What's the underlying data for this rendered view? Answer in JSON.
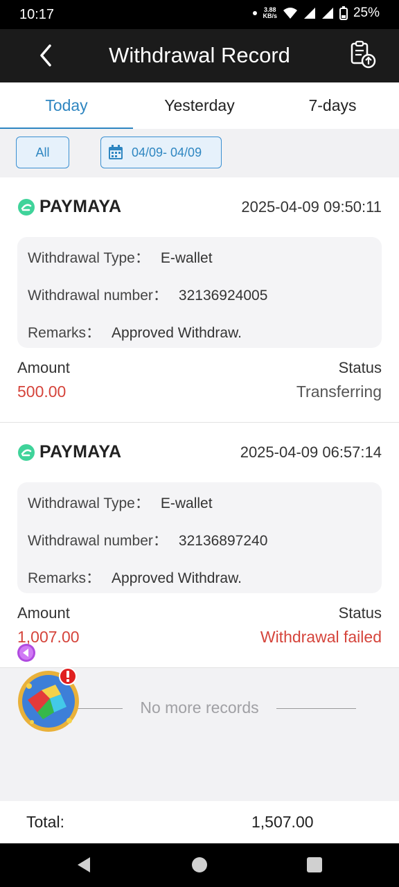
{
  "status_bar": {
    "time": "10:17",
    "net_speed_value": "3.88",
    "net_speed_unit": "KB/s",
    "battery": "25%"
  },
  "header": {
    "title": "Withdrawal Record"
  },
  "tabs": [
    {
      "label": "Today",
      "active": true
    },
    {
      "label": "Yesterday",
      "active": false
    },
    {
      "label": "7-days",
      "active": false
    }
  ],
  "filters": {
    "all_label": "All",
    "date_range": "04/09- 04/09"
  },
  "records": [
    {
      "brand": "PAYMAYA",
      "datetime": "2025-04-09 09:50:11",
      "type_label": "Withdrawal Type：",
      "type_value": "E-wallet",
      "number_label": "Withdrawal number：",
      "number_value": "32136924005",
      "remarks_label": "Remarks：",
      "remarks_value": "Approved Withdraw.",
      "amount_label": "Amount",
      "amount_value": "500.00",
      "status_label": "Status",
      "status_value": "Transferring"
    },
    {
      "brand": "PAYMAYA",
      "datetime": "2025-04-09 06:57:14",
      "type_label": "Withdrawal Type：",
      "type_value": "E-wallet",
      "number_label": "Withdrawal number：",
      "number_value": "32136897240",
      "remarks_label": "Remarks：",
      "remarks_value": "Approved Withdraw.",
      "amount_label": "Amount",
      "amount_value": "1,007.00",
      "status_label": "Status",
      "status_value": "Withdrawal failed"
    }
  ],
  "no_more": "No more records",
  "total": {
    "label": "Total:",
    "value": "1,507.00"
  },
  "colors": {
    "accent": "#2e86c1",
    "amount_red": "#d5443b",
    "paymaya_green": "#3fd39a"
  }
}
